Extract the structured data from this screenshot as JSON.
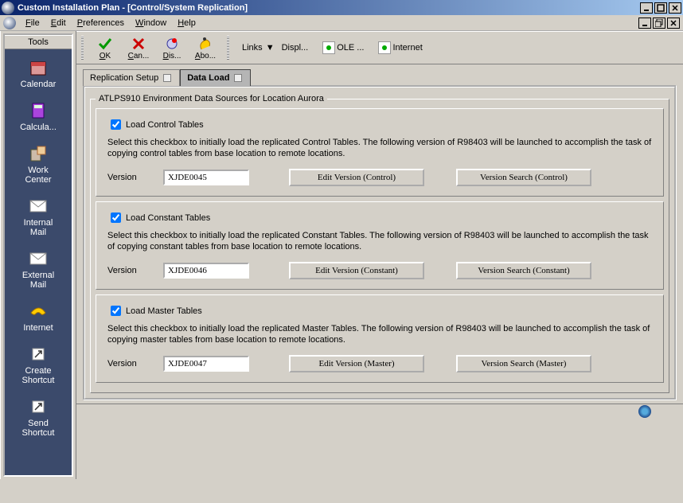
{
  "title": "Custom Installation Plan - [Control/System Replication]",
  "menu": {
    "file": "File",
    "edit": "Edit",
    "preferences": "Preferences",
    "window": "Window",
    "help": "Help"
  },
  "toolbar": {
    "ok": "OK",
    "cancel": "Can...",
    "display": "Dis...",
    "about": "Abo...",
    "links": "Links",
    "display_link": "Displ...",
    "ole": "OLE ...",
    "internet": "Internet"
  },
  "tools": {
    "title": "Tools",
    "calendar": "Calendar",
    "calculator": "Calcula...",
    "workcenter_l1": "Work",
    "workcenter_l2": "Center",
    "intmail_l1": "Internal",
    "intmail_l2": "Mail",
    "extmail_l1": "External",
    "extmail_l2": "Mail",
    "internet": "Internet",
    "createsc_l1": "Create",
    "createsc_l2": "Shortcut",
    "sendsc_l1": "Send",
    "sendsc_l2": "Shortcut"
  },
  "tabs": {
    "rep": "Replication Setup",
    "load": "Data Load"
  },
  "fieldset_legend": "ATLPS910 Environment Data Sources for Location Aurora",
  "sections": [
    {
      "chk_label": "Load Control Tables",
      "desc": "Select this checkbox to initially load the replicated Control Tables. The following version of R98403 will be launched to accomplish the task of copying control tables from base location to remote locations.",
      "ver_label": "Version",
      "ver_value": "XJDE0045",
      "btn_edit": "Edit Version (Control)",
      "btn_search": "Version Search (Control)"
    },
    {
      "chk_label": "Load Constant Tables",
      "desc": "Select this checkbox to initially load the replicated Constant Tables. The following version of R98403 will be launched to accomplish the task of copying constant tables from base location to remote locations.",
      "ver_label": "Version",
      "ver_value": "XJDE0046",
      "btn_edit": "Edit Version (Constant)",
      "btn_search": "Version Search (Constant)"
    },
    {
      "chk_label": "Load Master Tables",
      "desc": "Select this checkbox to initially load the replicated Master Tables. The following version of R98403 will be launched to accomplish the task of copying master tables from base location to remote locations.",
      "ver_label": "Version",
      "ver_value": "XJDE0047",
      "btn_edit": "Edit Version (Master)",
      "btn_search": "Version Search (Master)"
    }
  ]
}
